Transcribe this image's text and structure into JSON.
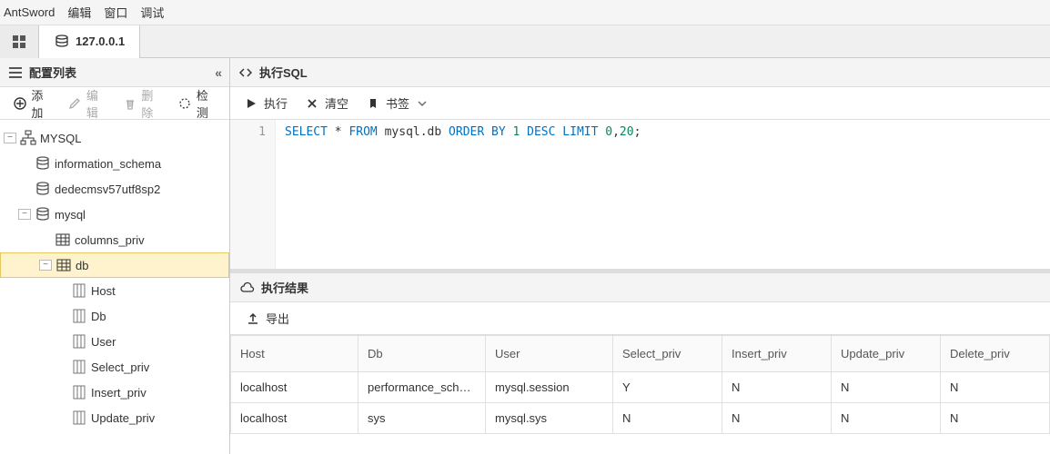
{
  "menu": {
    "app": "AntSword",
    "edit": "编辑",
    "window": "窗口",
    "debug": "调试"
  },
  "tabs": {
    "host": "127.0.0.1"
  },
  "sidebar": {
    "title": "配置列表",
    "toolbar": {
      "add": "添加",
      "edit": "编辑",
      "delete": "删除",
      "probe": "检测"
    },
    "tree": {
      "root": "MYSQL",
      "db1": "information_schema",
      "db2": "dedecmsv57utf8sp2",
      "db3": "mysql",
      "tbl1": "columns_priv",
      "tbl2": "db",
      "cols": [
        "Host",
        "Db",
        "User",
        "Select_priv",
        "Insert_priv",
        "Update_priv"
      ]
    }
  },
  "sql": {
    "title": "执行SQL",
    "run": "执行",
    "clear": "清空",
    "bookmark": "书签",
    "line_no": "1",
    "tokens": {
      "select": "SELECT",
      "star": "*",
      "from": "FROM",
      "table": "mysql.db",
      "orderby": "ORDER BY",
      "one": "1",
      "desc": "DESC",
      "limit": "LIMIT",
      "zero": "0",
      "comma": ",",
      "twenty": "20",
      "semi": ";"
    }
  },
  "result": {
    "title": "执行结果",
    "export": "导出",
    "headers": [
      "Host",
      "Db",
      "User",
      "Select_priv",
      "Insert_priv",
      "Update_priv",
      "Delete_priv"
    ],
    "rows": [
      [
        "localhost",
        "performance_schema",
        "mysql.session",
        "Y",
        "N",
        "N",
        "N"
      ],
      [
        "localhost",
        "sys",
        "mysql.sys",
        "N",
        "N",
        "N",
        "N"
      ]
    ]
  }
}
